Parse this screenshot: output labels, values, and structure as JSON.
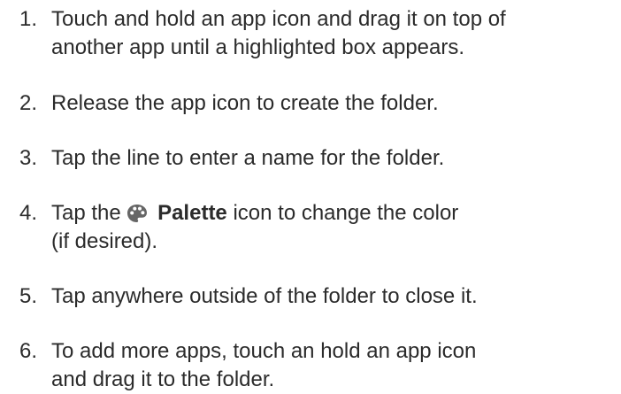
{
  "steps": [
    {
      "number": "1.",
      "lines": [
        "Touch and hold an app icon and drag it on top of",
        "another app until a highlighted box appears."
      ]
    },
    {
      "number": "2.",
      "lines": [
        "Release the app icon to create the folder."
      ]
    },
    {
      "number": "3.",
      "lines": [
        "Tap the line to enter a name for the folder."
      ]
    },
    {
      "number": "4.",
      "prefix": "Tap the",
      "icon": "palette-icon",
      "bold": "Palette",
      "suffix": "icon to change the color",
      "line2": "(if desired)."
    },
    {
      "number": "5.",
      "lines": [
        "Tap anywhere outside of the folder to close it."
      ]
    },
    {
      "number": "6.",
      "lines": [
        "To add more apps, touch an hold an app icon",
        "and drag it to the folder."
      ]
    }
  ]
}
